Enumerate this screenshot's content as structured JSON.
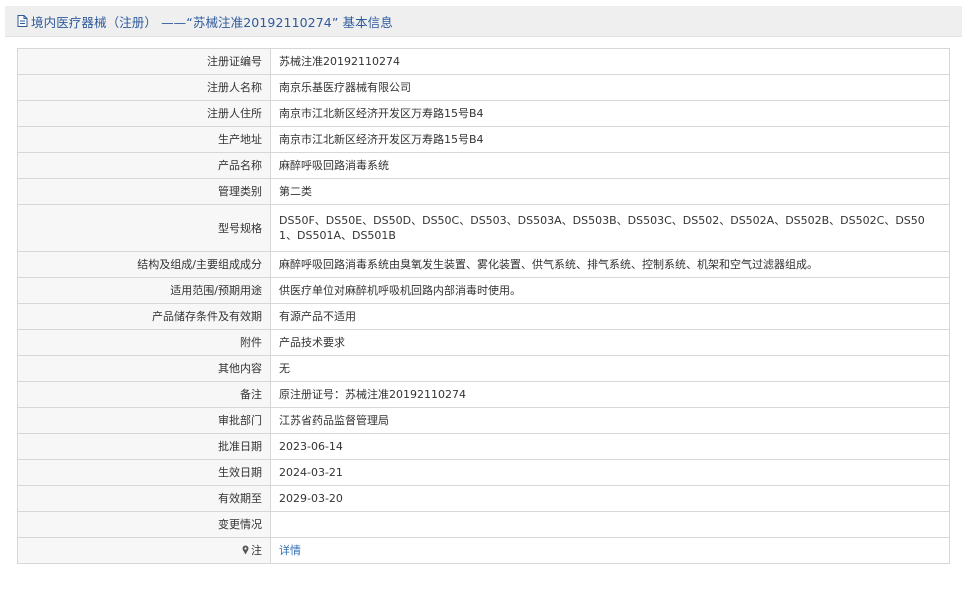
{
  "header": {
    "title": "境内医疗器械（注册） ——“苏械注准20192110274” 基本信息"
  },
  "rows": [
    {
      "label": "注册证编号",
      "value": "苏械注准20192110274"
    },
    {
      "label": "注册人名称",
      "value": "南京乐基医疗器械有限公司"
    },
    {
      "label": "注册人住所",
      "value": "南京市江北新区经济开发区万寿路15号B4"
    },
    {
      "label": "生产地址",
      "value": "南京市江北新区经济开发区万寿路15号B4"
    },
    {
      "label": "产品名称",
      "value": "麻醉呼吸回路消毒系统"
    },
    {
      "label": "管理类别",
      "value": "第二类"
    },
    {
      "label": "型号规格",
      "value": "DS50F、DS50E、DS50D、DS50C、DS503、DS503A、DS503B、DS503C、DS502、DS502A、DS502B、DS502C、DS501、DS501A、DS501B"
    },
    {
      "label": "结构及组成/主要组成成分",
      "value": "麻醉呼吸回路消毒系统由臭氧发生装置、雾化装置、供气系统、排气系统、控制系统、机架和空气过滤器组成。"
    },
    {
      "label": "适用范围/预期用途",
      "value": "供医疗单位对麻醉机呼吸机回路内部消毒时使用。"
    },
    {
      "label": "产品储存条件及有效期",
      "value": "有源产品不适用"
    },
    {
      "label": "附件",
      "value": "产品技术要求"
    },
    {
      "label": "其他内容",
      "value": "无"
    },
    {
      "label": "备注",
      "value": "原注册证号：苏械注准20192110274"
    },
    {
      "label": "审批部门",
      "value": "江苏省药品监督管理局"
    },
    {
      "label": "批准日期",
      "value": "2023-06-14"
    },
    {
      "label": "生效日期",
      "value": "2024-03-21"
    },
    {
      "label": "有效期至",
      "value": "2029-03-20"
    },
    {
      "label": "变更情况",
      "value": ""
    },
    {
      "label": "注",
      "value": "详情"
    }
  ],
  "icons": {
    "header_icon": "document-icon",
    "note_icon": "pin-icon"
  },
  "colors": {
    "title": "#2e5a9c",
    "link": "#2e6cb5",
    "label_bg": "#f7f7f7",
    "header_bg": "#efefef",
    "border": "#d7d7d7"
  }
}
